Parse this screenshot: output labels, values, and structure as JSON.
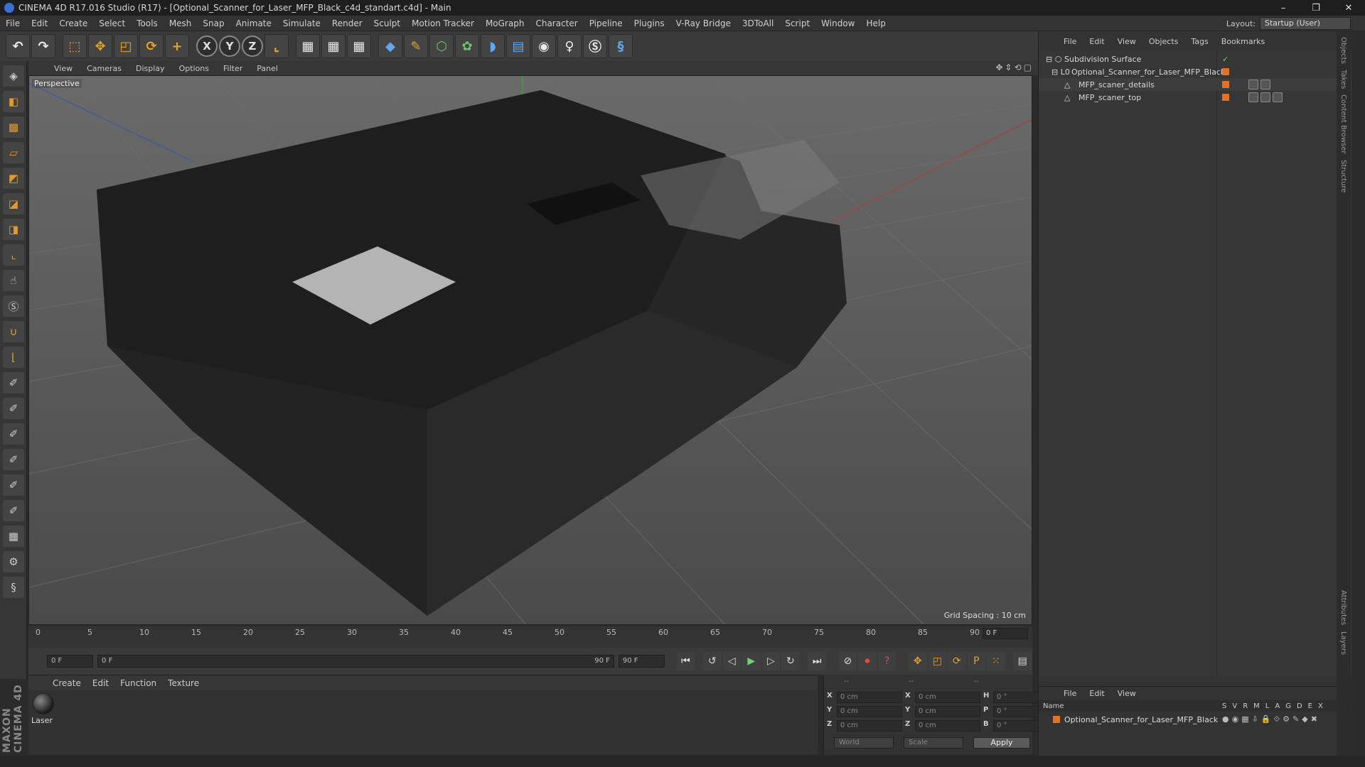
{
  "window": {
    "title": "CINEMA 4D R17.016 Studio (R17) - [Optional_Scanner_for_Laser_MFP_Black_c4d_standart.c4d] - Main",
    "controls": [
      "–",
      "❐",
      "✕"
    ]
  },
  "menubar": {
    "items": [
      "File",
      "Edit",
      "Create",
      "Select",
      "Tools",
      "Mesh",
      "Snap",
      "Animate",
      "Simulate",
      "Render",
      "Sculpt",
      "Motion Tracker",
      "MoGraph",
      "Character",
      "Pipeline",
      "Plugins",
      "V-Ray Bridge",
      "3DToAll",
      "Script",
      "Window",
      "Help"
    ],
    "layout_label": "Layout:",
    "layout_value": "Startup (User)"
  },
  "viewport": {
    "menu": [
      "View",
      "Cameras",
      "Display",
      "Options",
      "Filter",
      "Panel"
    ],
    "label": "Perspective",
    "grid_spacing": "Grid Spacing : 10 cm"
  },
  "timeline": {
    "ticks": [
      "0",
      "5",
      "10",
      "15",
      "20",
      "25",
      "30",
      "35",
      "40",
      "45",
      "50",
      "55",
      "60",
      "65",
      "70",
      "75",
      "80",
      "85",
      "90"
    ],
    "current_frame": "0 F",
    "start_field": "0 F",
    "range_start": "0 F",
    "range_end": "90 F",
    "end_field": "90 F"
  },
  "materials": {
    "menu": [
      "Create",
      "Edit",
      "Function",
      "Texture"
    ],
    "items": [
      {
        "name": "Laser"
      }
    ]
  },
  "coordinates": {
    "header": [
      "--",
      "--",
      "--"
    ],
    "rows": [
      {
        "a": "X",
        "a_val": "0 cm",
        "b": "X",
        "b_val": "0 cm",
        "c": "H",
        "c_val": "0 °"
      },
      {
        "a": "Y",
        "a_val": "0 cm",
        "b": "Y",
        "b_val": "0 cm",
        "c": "P",
        "c_val": "0 °"
      },
      {
        "a": "Z",
        "a_val": "0 cm",
        "b": "Z",
        "b_val": "0 cm",
        "c": "B",
        "c_val": "0 °"
      }
    ],
    "space": "World",
    "mode": "Scale",
    "apply": "Apply"
  },
  "objects": {
    "menu": [
      "File",
      "Edit",
      "View",
      "Objects",
      "Tags",
      "Bookmarks"
    ],
    "tree": [
      {
        "name": "Subdivision Surface",
        "depth": 0
      },
      {
        "name": "Optional_Scanner_for_Laser_MFP_Black",
        "depth": 1
      },
      {
        "name": "MFP_scaner_details",
        "depth": 2
      },
      {
        "name": "MFP_scaner_top",
        "depth": 2
      }
    ]
  },
  "layers": {
    "menu": [
      "File",
      "Edit",
      "View"
    ],
    "columns": [
      "Name",
      "S",
      "V",
      "R",
      "M",
      "L",
      "A",
      "G",
      "D",
      "E",
      "X"
    ],
    "rows": [
      {
        "name": "Optional_Scanner_for_Laser_MFP_Black"
      }
    ]
  },
  "side_tabs": [
    "Objects",
    "Takes",
    "Content Browser",
    "Structure",
    "Attributes",
    "Layers"
  ],
  "brand": "MAXON CINEMA 4D",
  "colors": {
    "accent_orange": "#e27228",
    "viewport_bg": "#5a5a5a",
    "panel_bg": "#333333"
  }
}
